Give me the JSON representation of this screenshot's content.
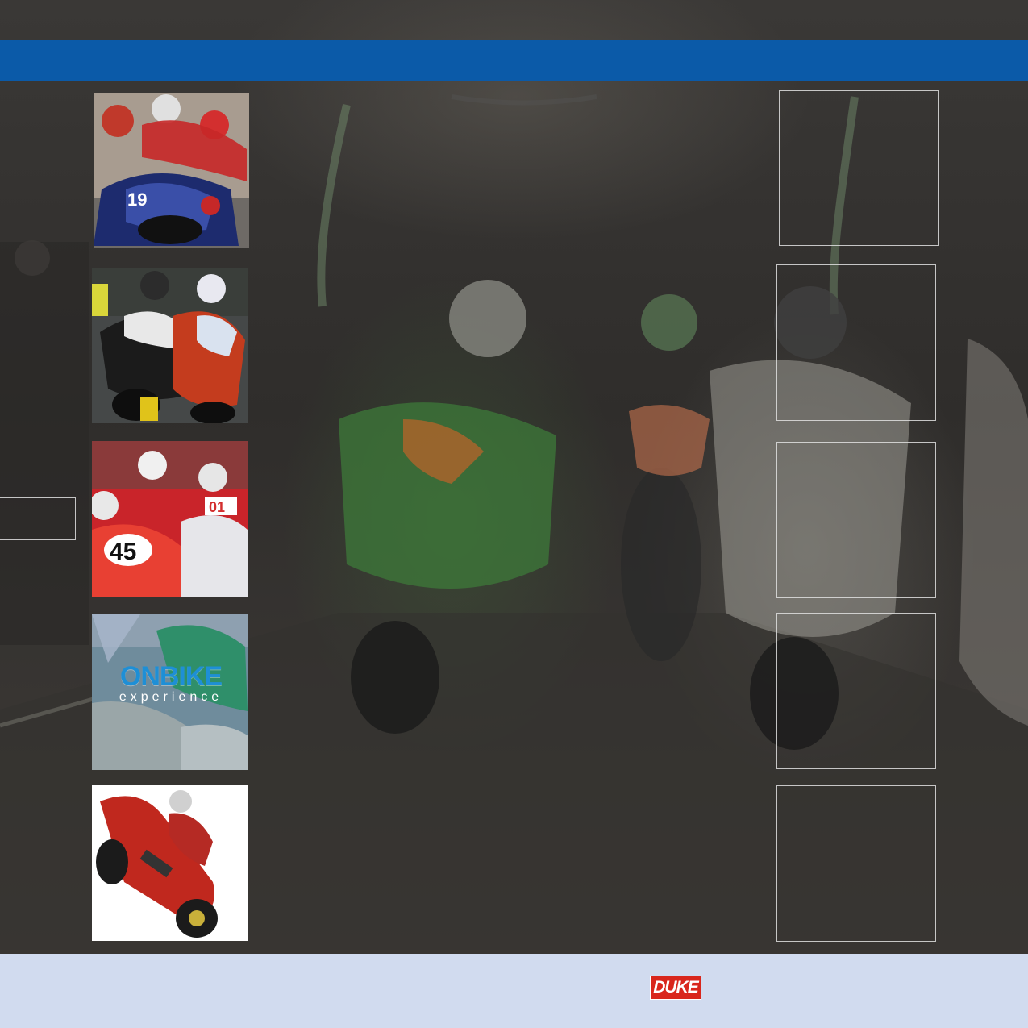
{
  "colors": {
    "top_band": "#0b5aa8",
    "bottom_band": "#d1dbef",
    "logo_red": "#d9261c",
    "onbike_blue": "#1e8fd6"
  },
  "logo": {
    "text": "DUKE"
  },
  "thumbnails": [
    {
      "name": "superbike-pack-photo"
    },
    {
      "name": "road-race-duel-photo"
    },
    {
      "name": "number-45-race-photo"
    },
    {
      "name": "onbike-experience-cover",
      "title": "ONBIKE",
      "subtitle": "experience"
    },
    {
      "name": "stunt-wheelie-photo"
    }
  ],
  "frames": [
    {
      "name": "empty-frame-1"
    },
    {
      "name": "empty-frame-2"
    },
    {
      "name": "empty-frame-3"
    },
    {
      "name": "empty-frame-4"
    },
    {
      "name": "empty-frame-5"
    },
    {
      "name": "left-edge-frame"
    }
  ]
}
